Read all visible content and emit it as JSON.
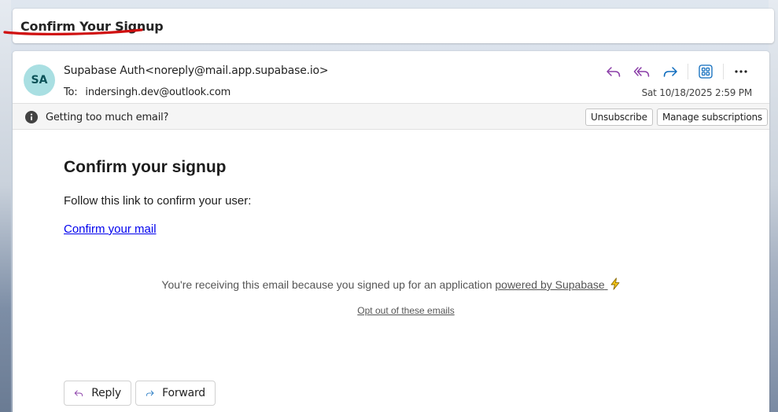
{
  "subject": {
    "title": "Confirm Your Signup"
  },
  "message": {
    "avatar_initials": "SA",
    "sender": "Supabase Auth<noreply@mail.app.supabase.io>",
    "to_label": "To:",
    "to_address": "indersingh.dev@outlook.com",
    "date": "Sat 10/18/2025 2:59 PM",
    "actions": [
      "reply-icon",
      "reply-all-icon",
      "forward-icon",
      "apps-icon",
      "more-icon"
    ]
  },
  "infobar": {
    "text": "Getting too much email?",
    "unsubscribe_label": "Unsubscribe",
    "manage_label": "Manage subscriptions"
  },
  "body": {
    "heading": "Confirm your signup",
    "paragraph": "Follow this link to confirm your user:",
    "link": "Confirm your mail",
    "footer_text": "You're receiving this email because you signed up for an application",
    "footer_link": "powered by Supabase",
    "optout": "Opt out of these emails"
  },
  "bottom": {
    "reply_label": "Reply",
    "forward_label": "Forward"
  },
  "colors": {
    "accent": "#8b3fa8",
    "forward_blue": "#0f6cbd",
    "underline_red": "#d01010",
    "avatar_bg": "#a9dfe2"
  }
}
